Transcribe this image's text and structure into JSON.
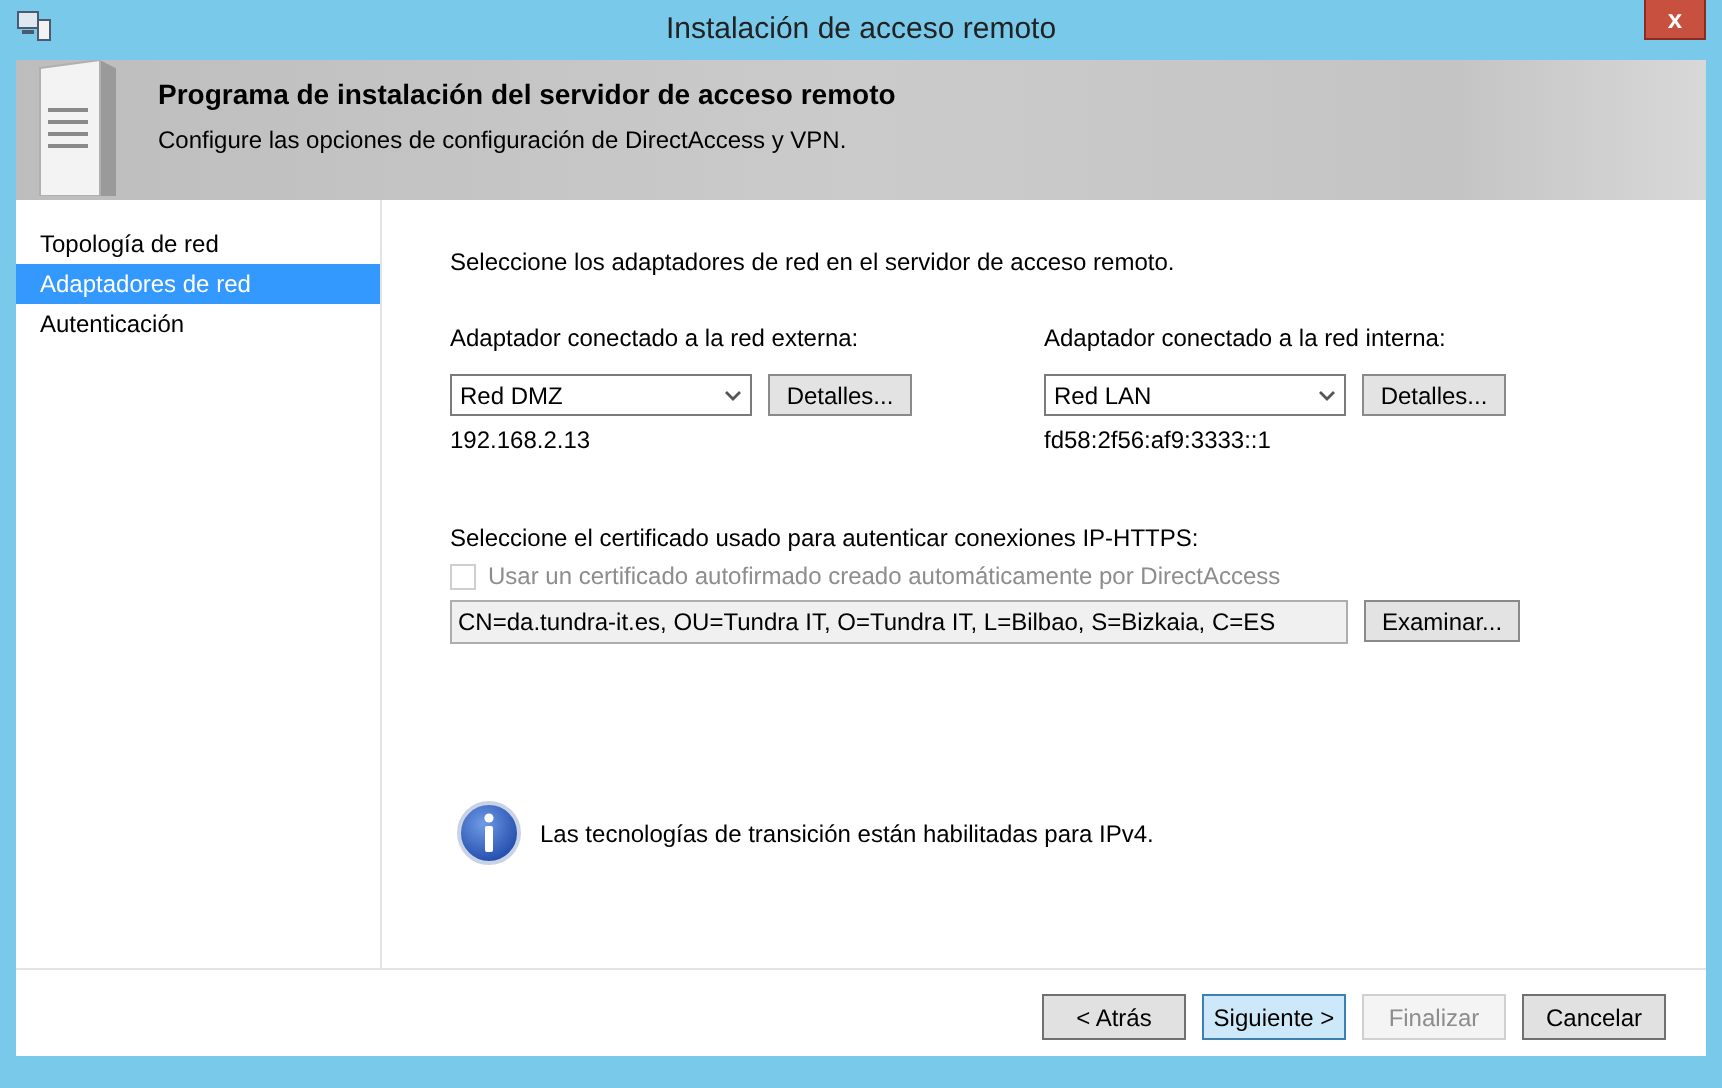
{
  "window": {
    "title": "Instalación de acceso remoto",
    "close": "x"
  },
  "header": {
    "title": "Programa de instalación del servidor de acceso remoto",
    "subtitle": "Configure las opciones de configuración de DirectAccess y VPN."
  },
  "steps": [
    {
      "label": "Topología de red",
      "selected": false
    },
    {
      "label": "Adaptadores de red",
      "selected": true
    },
    {
      "label": "Autenticación",
      "selected": false
    }
  ],
  "intro": "Seleccione los adaptadores de red en el servidor de acceso remoto.",
  "adapters": [
    {
      "label": "Adaptador conectado a la red externa:",
      "value": "Red DMZ",
      "button": "Detalles...",
      "address": "192.168.2.13"
    },
    {
      "label": "Adaptador conectado a la red interna:",
      "value": "Red LAN",
      "button": "Detalles...",
      "address": "fd58:2f56:af9:3333::1"
    }
  ],
  "certificate": {
    "label": "Seleccione el certificado usado para autenticar conexiones IP-HTTPS:",
    "self_signed": {
      "label": "Usar un certificado autofirmado creado automáticamente por DirectAccess",
      "checked": false,
      "disabled": true
    },
    "value": "CN=da.tundra-it.es, OU=Tundra IT, O=Tundra IT, L=Bilbao, S=Bizkaia, C=ES",
    "button": "Examinar..."
  },
  "info": "Las tecnologías de transición están habilitadas para IPv4.",
  "buttons": [
    {
      "label": "< Atrás",
      "default": false,
      "disabled": false
    },
    {
      "label": "Siguiente >",
      "default": true,
      "disabled": false
    },
    {
      "label": "Finalizar",
      "default": false,
      "disabled": true
    },
    {
      "label": "Cancelar",
      "default": false,
      "disabled": false
    }
  ]
}
